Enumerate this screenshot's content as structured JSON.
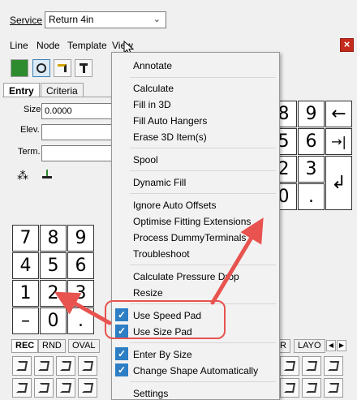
{
  "service": {
    "label": "Service",
    "value": "Return 4in"
  },
  "menubar": {
    "items": [
      "Line",
      "Node",
      "Template",
      "View"
    ]
  },
  "tabs": [
    "Entry",
    "Criteria"
  ],
  "entry": {
    "size_label": "Size",
    "size_value": "0.0000",
    "elev_label": "Elev.",
    "term_label": "Term."
  },
  "keypad_left": [
    "7",
    "8",
    "9",
    "4",
    "5",
    "6",
    "1",
    "2",
    "3",
    "–",
    "0",
    "."
  ],
  "keypad_right": [
    "8",
    "9",
    "←",
    "5",
    "6",
    "→|",
    "2",
    "3",
    "↲",
    "0",
    "."
  ],
  "bottom_tabs": [
    "REC",
    "RND",
    "OVAL",
    "R",
    "LAYO"
  ],
  "dropdown": {
    "items": [
      {
        "label": "Annotate"
      },
      {
        "label": "Calculate"
      },
      {
        "label": "Fill in 3D"
      },
      {
        "label": "Fill Auto Hangers"
      },
      {
        "label": "Erase 3D Item(s)"
      },
      {
        "label": "Spool"
      },
      {
        "label": "Dynamic Fill"
      },
      {
        "label": "Ignore Auto Offsets"
      },
      {
        "label": "Optimise Fitting Extensions"
      },
      {
        "label": "Process DummyTerminals"
      },
      {
        "label": "Troubleshoot"
      },
      {
        "label": "Calculate Pressure Drop"
      },
      {
        "label": "Resize"
      },
      {
        "label": "Use Speed Pad",
        "checked": true
      },
      {
        "label": "Use Size Pad",
        "checked": true
      },
      {
        "label": "Enter By Size",
        "checked": true
      },
      {
        "label": "Change Shape Automatically",
        "checked": true
      },
      {
        "label": "Settings"
      }
    ]
  },
  "colors": {
    "highlight": "#e8534f",
    "check": "#2d7ec4",
    "close": "#c42b1c"
  },
  "icons": [
    "cursor-icon",
    "close-icon",
    "check-icon",
    "arrow-annotation-icon"
  ]
}
